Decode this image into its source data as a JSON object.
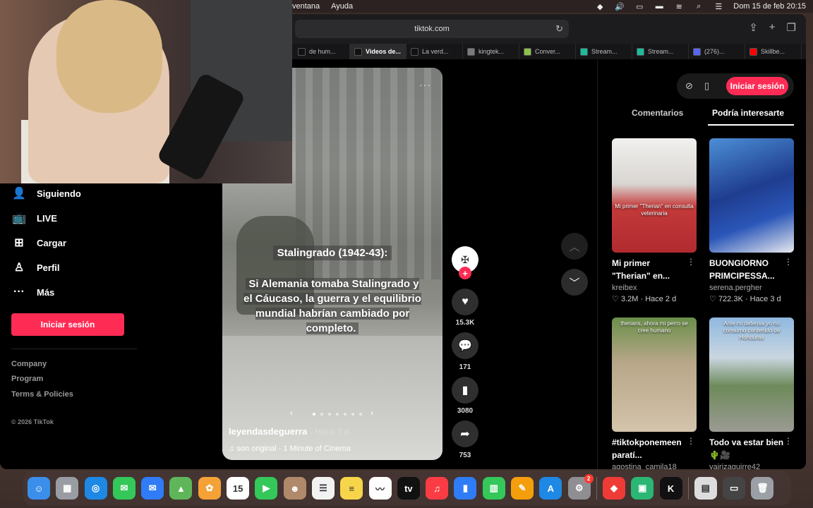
{
  "menubar": {
    "menus": [
      "ventana",
      "Ayuda"
    ],
    "clock": "Dom 15 de feb  20:15"
  },
  "browser": {
    "url": "tiktok.com",
    "tabs": [
      {
        "label": "de hum...",
        "favicon_color": "#111111",
        "active": false
      },
      {
        "label": "Videos de...",
        "favicon_color": "#111111",
        "active": true
      },
      {
        "label": "La verd...",
        "favicon_color": "#111111",
        "active": false
      },
      {
        "label": "kingtek...",
        "favicon_color": "#7a7a7a",
        "active": false
      },
      {
        "label": "Conver...",
        "favicon_color": "#8bc34a",
        "active": false
      },
      {
        "label": "Stream...",
        "favicon_color": "#1abc9c",
        "active": false
      },
      {
        "label": "Stream...",
        "favicon_color": "#1abc9c",
        "active": false
      },
      {
        "label": "(276)...",
        "favicon_color": "#5865f2",
        "active": false
      },
      {
        "label": "Skillbe...",
        "favicon_color": "#ff0000",
        "active": false
      }
    ]
  },
  "sidebar": {
    "items": [
      {
        "label": "Siguiendo",
        "icon": "user-plus-icon"
      },
      {
        "label": "LIVE",
        "icon": "live-tv-icon"
      },
      {
        "label": "Cargar",
        "icon": "upload-plus-icon"
      },
      {
        "label": "Perfil",
        "icon": "user-icon"
      },
      {
        "label": "Más",
        "icon": "more-dots-icon"
      }
    ],
    "login_label": "Iniciar sesión",
    "footer_links": [
      "Company",
      "Program",
      "Terms & Policies"
    ],
    "copyright": "© 2026 TikTok"
  },
  "video": {
    "title": "Stalingrado (1942-43):",
    "body": "Si Alemania tomaba Stalingrado y el Cáucaso, la guerra y el equilibrio mundial habrían cambiado por completo.",
    "author": "leyendasdeguerra",
    "when": "· Hace 3 d",
    "music": "son original - 1 Minute of Cinema",
    "more": "···"
  },
  "actions": {
    "likes": "15.3K",
    "comments": "171",
    "saves": "3080",
    "shares": "753"
  },
  "right_panel": {
    "login_label": "Iniciar sesión",
    "tabs": [
      "Comentarios",
      "Podría interesarte"
    ],
    "cards": [
      {
        "title": "Mi primer \"Therian\" en...",
        "caption": "Mi primer \"Therian\" en consulta veterinaria",
        "user": "kreibex",
        "likes": "3.2M",
        "when": "Hace 2 d"
      },
      {
        "title": "BUONGIORNO PRIMCIPESSA...",
        "caption": "",
        "user": "serena.pergher",
        "likes": "722.3K",
        "when": "Hace 3 d"
      },
      {
        "title": "#tiktokponemeen paratí...",
        "caption": "therians, ahora mi perro se cree humano",
        "user": "agostina_camila18",
        "likes": "",
        "when": ""
      },
      {
        "title": "Todo va estar bien 🌵🎥",
        "caption": "Ante mi defensa yo no consumo contenido de Honduras",
        "user": "vairizaguirre42",
        "likes": "",
        "when": ""
      }
    ]
  },
  "dock": {
    "apps": [
      {
        "name": "finder",
        "color": "#3b8eea",
        "glyph": "☺"
      },
      {
        "name": "launchpad",
        "color": "#9a9ca3",
        "glyph": "▦"
      },
      {
        "name": "safari",
        "color": "#1e88e5",
        "glyph": "◎"
      },
      {
        "name": "messages",
        "color": "#34c759",
        "glyph": "✉"
      },
      {
        "name": "mail",
        "color": "#2f7cf6",
        "glyph": "✉"
      },
      {
        "name": "maps",
        "color": "#5fb65a",
        "glyph": "▲"
      },
      {
        "name": "photos",
        "color": "#f4a236",
        "glyph": "✿"
      },
      {
        "name": "calendar",
        "color": "#ffffff",
        "glyph": "15"
      },
      {
        "name": "facetime",
        "color": "#34c759",
        "glyph": "▶"
      },
      {
        "name": "contacts",
        "color": "#b0896a",
        "glyph": "☻"
      },
      {
        "name": "reminders",
        "color": "#f2f2f2",
        "glyph": "☰"
      },
      {
        "name": "notes",
        "color": "#f7d54a",
        "glyph": "≡"
      },
      {
        "name": "freeform",
        "color": "#ffffff",
        "glyph": "〰"
      },
      {
        "name": "tv",
        "color": "#111111",
        "glyph": "tv"
      },
      {
        "name": "music",
        "color": "#fc3c44",
        "glyph": "♫"
      },
      {
        "name": "keynote",
        "color": "#2f7cf6",
        "glyph": "▮"
      },
      {
        "name": "numbers",
        "color": "#34c759",
        "glyph": "▥"
      },
      {
        "name": "pages",
        "color": "#f59e0b",
        "glyph": "✎"
      },
      {
        "name": "app-store",
        "color": "#1e88e5",
        "glyph": "A"
      },
      {
        "name": "system-settings",
        "color": "#8e8e93",
        "glyph": "⚙",
        "badge": "2"
      },
      {
        "name": "anydesk",
        "color": "#ef3b36",
        "glyph": "◆"
      },
      {
        "name": "android-studio",
        "color": "#2bb673",
        "glyph": "▣"
      },
      {
        "name": "kick",
        "color": "#111111",
        "glyph": "K"
      },
      {
        "name": "preview",
        "color": "#dddddd",
        "glyph": "▤"
      },
      {
        "name": "screen-recorder",
        "color": "#444444",
        "glyph": "▭"
      },
      {
        "name": "trash",
        "color": "#9aa0a6",
        "glyph": "🗑"
      }
    ]
  }
}
